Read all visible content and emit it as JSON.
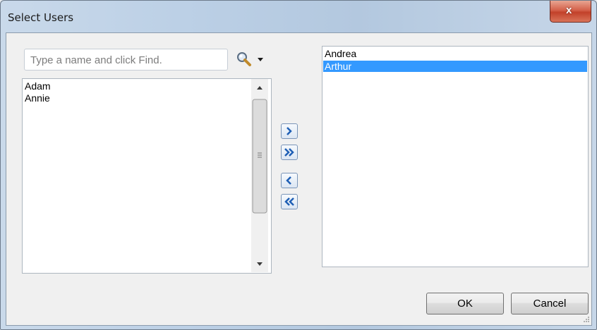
{
  "window": {
    "title": "Select Users",
    "close_glyph": "x"
  },
  "search": {
    "placeholder": "Type a name and click Find."
  },
  "available_users": [
    "Adam",
    "Annie"
  ],
  "selected_users": [
    "Andrea",
    "Arthur"
  ],
  "selected_highlight": "Arthur",
  "transfer_buttons": [
    "add-selected",
    "add-all",
    "remove-selected",
    "remove-all"
  ],
  "footer": {
    "ok_label": "OK",
    "cancel_label": "Cancel"
  },
  "colors": {
    "selection": "#3399ff",
    "close_button": "#c2412a"
  }
}
